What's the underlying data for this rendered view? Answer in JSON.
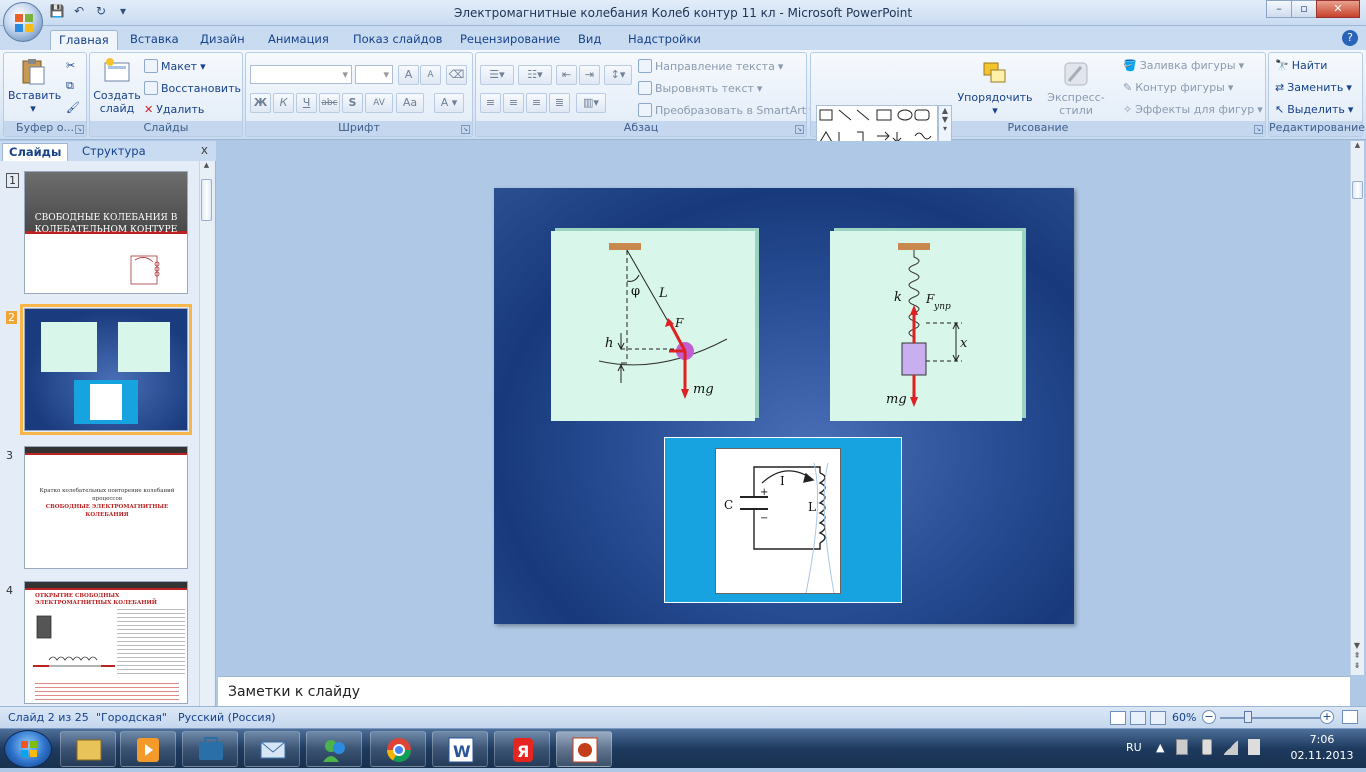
{
  "app": {
    "title": "Электромагнитные колебания Колеб контур 11 кл - Microsoft PowerPoint"
  },
  "qat": {
    "undo": "↶",
    "redo": "↻",
    "more": "▾"
  },
  "tabs": [
    "Главная",
    "Вставка",
    "Дизайн",
    "Анимация",
    "Показ слайдов",
    "Рецензирование",
    "Вид",
    "Надстройки"
  ],
  "ribbon": {
    "clipboard": {
      "label": "Буфер о...",
      "paste": "Вставить"
    },
    "slides": {
      "label": "Слайды",
      "new_slide": "Создать слайд",
      "layout": "Макет",
      "reset": "Восстановить",
      "delete": "Удалить"
    },
    "font": {
      "label": "Шрифт",
      "bold": "Ж",
      "italic": "К",
      "underline": "Ч",
      "strike": "abc",
      "shadow": "S",
      "spacing": "AV",
      "case": "Aa",
      "grow": "A",
      "shrink": "A"
    },
    "paragraph": {
      "label": "Абзац",
      "text_direction": "Направление текста",
      "align_text": "Выровнять текст",
      "smartart": "Преобразовать в SmartArt"
    },
    "drawing": {
      "label": "Рисование",
      "arrange": "Упорядочить",
      "quick_styles": "Экспресс-стили",
      "fill": "Заливка фигуры",
      "outline": "Контур фигуры",
      "effects": "Эффекты для фигур"
    },
    "editing": {
      "label": "Редактирование",
      "find": "Найти",
      "replace": "Заменить",
      "select": "Выделить"
    }
  },
  "panel": {
    "tab_slides": "Слайды",
    "tab_outline": "Структура",
    "close": "x"
  },
  "thumbs": [
    {
      "num": "1",
      "title": "СВОБОДНЫЕ КОЛЕБАНИЯ В КОЛЕБАТЕЛЬНОМ КОНТУРЕ"
    },
    {
      "num": "2"
    },
    {
      "num": "3",
      "text": "Кратко колебательных повторение колебаний процессов",
      "red": "СВОБОДНЫЕ ЭЛЕКТРОМАГНИТНЫЕ КОЛЕБАНИЯ"
    },
    {
      "num": "4",
      "title": "ОТКРЫТИЕ СВОБОДНЫХ ЭЛЕКТРОМАГНИТНЫХ КОЛЕБАНИЙ"
    }
  ],
  "slide": {
    "pendulum": {
      "phi": "φ",
      "L": "L",
      "F": "F",
      "h": "h",
      "mg": "mg"
    },
    "spring": {
      "k": "k",
      "F": "F",
      "sub": "упр",
      "x": "x",
      "mg": "mg"
    },
    "circuit": {
      "C": "C",
      "I": "I",
      "L": "L"
    }
  },
  "notes": {
    "placeholder": "Заметки к слайду"
  },
  "status": {
    "slide": "Слайд 2 из 25",
    "theme": "\"Городская\"",
    "lang": "Русский (Россия)",
    "zoom": "60%"
  },
  "tray": {
    "lang": "RU",
    "time": "7:06",
    "date": "02.11.2013"
  }
}
